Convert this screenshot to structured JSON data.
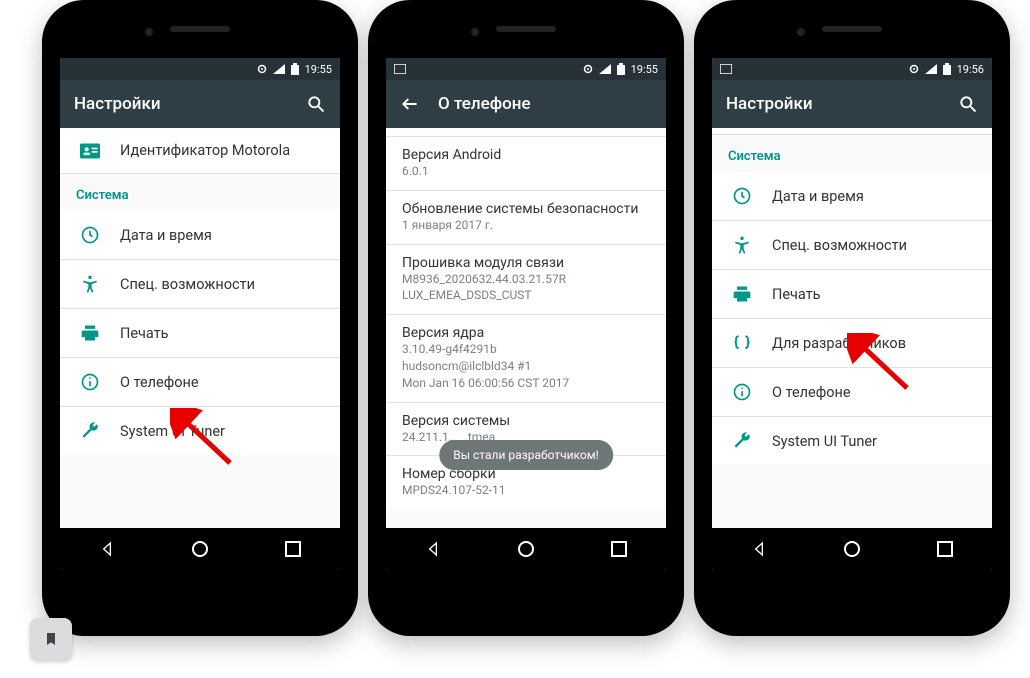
{
  "colors": {
    "accent": "#009688",
    "appbar": "#2f3d44",
    "statusbar": "#263238",
    "arrow": "#e60000"
  },
  "phone1": {
    "status_time": "19:55",
    "appbar_title": "Настройки",
    "first_row": "Идентификатор Motorola",
    "section_header": "Система",
    "items": [
      {
        "icon": "clock-icon",
        "label": "Дата и время"
      },
      {
        "icon": "accessibility-icon",
        "label": "Спец. возможности"
      },
      {
        "icon": "print-icon",
        "label": "Печать"
      },
      {
        "icon": "info-icon",
        "label": "О телефоне"
      },
      {
        "icon": "wrench-icon",
        "label": "System UI Tuner"
      }
    ]
  },
  "phone2": {
    "status_time": "19:55",
    "appbar_title": "О телефоне",
    "details": [
      {
        "title": "Версия Android",
        "value": "6.0.1"
      },
      {
        "title": "Обновление системы безопасности",
        "value": "1 января 2017 г."
      },
      {
        "title": "Прошивка модуля связи",
        "value": "M8936_2020632.44.03.21.57R\nLUX_EMEA_DSDS_CUST"
      },
      {
        "title": "Версия ядра",
        "value": "3.10.49-g4f4291b\nhudsoncm@ilclbld34 #1\nMon Jan 16 06:00:56 CST 2017"
      },
      {
        "title": "Версия системы",
        "value": "24.211.1…                          …tmea"
      },
      {
        "title": "Номер сборки",
        "value": "MPDS24.107-52-11"
      }
    ],
    "toast": "Вы стали разработчиком!"
  },
  "phone3": {
    "status_time": "19:56",
    "appbar_title": "Настройки",
    "section_header": "Система",
    "items": [
      {
        "icon": "clock-icon",
        "label": "Дата и время"
      },
      {
        "icon": "accessibility-icon",
        "label": "Спец. возможности"
      },
      {
        "icon": "print-icon",
        "label": "Печать"
      },
      {
        "icon": "braces-icon",
        "label": "Для разработчиков"
      },
      {
        "icon": "info-icon",
        "label": "О телефоне"
      },
      {
        "icon": "wrench-icon",
        "label": "System UI Tuner"
      }
    ]
  }
}
